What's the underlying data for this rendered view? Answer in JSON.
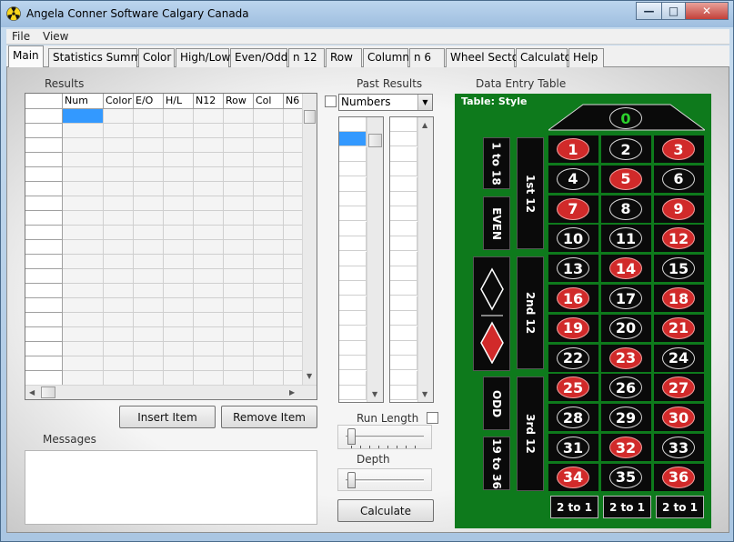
{
  "window": {
    "title": "Angela Conner Software  Calgary Canada"
  },
  "window_buttons": {
    "minimize": "—",
    "maximize": "□",
    "close": "✕"
  },
  "menu": [
    "File",
    "View"
  ],
  "tabs": [
    "Main",
    "Statistics Summary",
    "Color",
    "High/Low",
    "Even/Odd",
    "n 12",
    "Row",
    "Column",
    "n 6",
    "Wheel Sector",
    "Calculator",
    "Help"
  ],
  "results": {
    "label": "Results",
    "columns": [
      "Num",
      "Color",
      "E/O",
      "H/L",
      "N12",
      "Row",
      "Col",
      "N6"
    ]
  },
  "buttons": {
    "insert": "Insert Item",
    "remove": "Remove Item",
    "calculate": "Calculate"
  },
  "messages": {
    "label": "Messages"
  },
  "past_results": {
    "label": "Past Results",
    "selected": "Numbers"
  },
  "run_length": {
    "label": "Run Length"
  },
  "depth": {
    "label": "Depth"
  },
  "data_entry": {
    "label": "Data Entry Table",
    "table_title": "Table: Style",
    "zero": "0",
    "numbers": [
      {
        "n": "1",
        "c": "red"
      },
      {
        "n": "2",
        "c": "black"
      },
      {
        "n": "3",
        "c": "red"
      },
      {
        "n": "4",
        "c": "black"
      },
      {
        "n": "5",
        "c": "red"
      },
      {
        "n": "6",
        "c": "black"
      },
      {
        "n": "7",
        "c": "red"
      },
      {
        "n": "8",
        "c": "black"
      },
      {
        "n": "9",
        "c": "red"
      },
      {
        "n": "10",
        "c": "black"
      },
      {
        "n": "11",
        "c": "black"
      },
      {
        "n": "12",
        "c": "red"
      },
      {
        "n": "13",
        "c": "black"
      },
      {
        "n": "14",
        "c": "red"
      },
      {
        "n": "15",
        "c": "black"
      },
      {
        "n": "16",
        "c": "red"
      },
      {
        "n": "17",
        "c": "black"
      },
      {
        "n": "18",
        "c": "red"
      },
      {
        "n": "19",
        "c": "red"
      },
      {
        "n": "20",
        "c": "black"
      },
      {
        "n": "21",
        "c": "red"
      },
      {
        "n": "22",
        "c": "black"
      },
      {
        "n": "23",
        "c": "red"
      },
      {
        "n": "24",
        "c": "black"
      },
      {
        "n": "25",
        "c": "red"
      },
      {
        "n": "26",
        "c": "black"
      },
      {
        "n": "27",
        "c": "red"
      },
      {
        "n": "28",
        "c": "black"
      },
      {
        "n": "29",
        "c": "black"
      },
      {
        "n": "30",
        "c": "red"
      },
      {
        "n": "31",
        "c": "black"
      },
      {
        "n": "32",
        "c": "red"
      },
      {
        "n": "33",
        "c": "black"
      },
      {
        "n": "34",
        "c": "red"
      },
      {
        "n": "35",
        "c": "black"
      },
      {
        "n": "36",
        "c": "red"
      }
    ],
    "dozens": [
      "1st 12",
      "2nd 12",
      "3rd 12"
    ],
    "outside": [
      "1 to 18",
      "EVEN",
      "ODD",
      "19 to 36"
    ],
    "columns_bet": [
      "2 to 1",
      "2 to 1",
      "2 to 1"
    ]
  }
}
